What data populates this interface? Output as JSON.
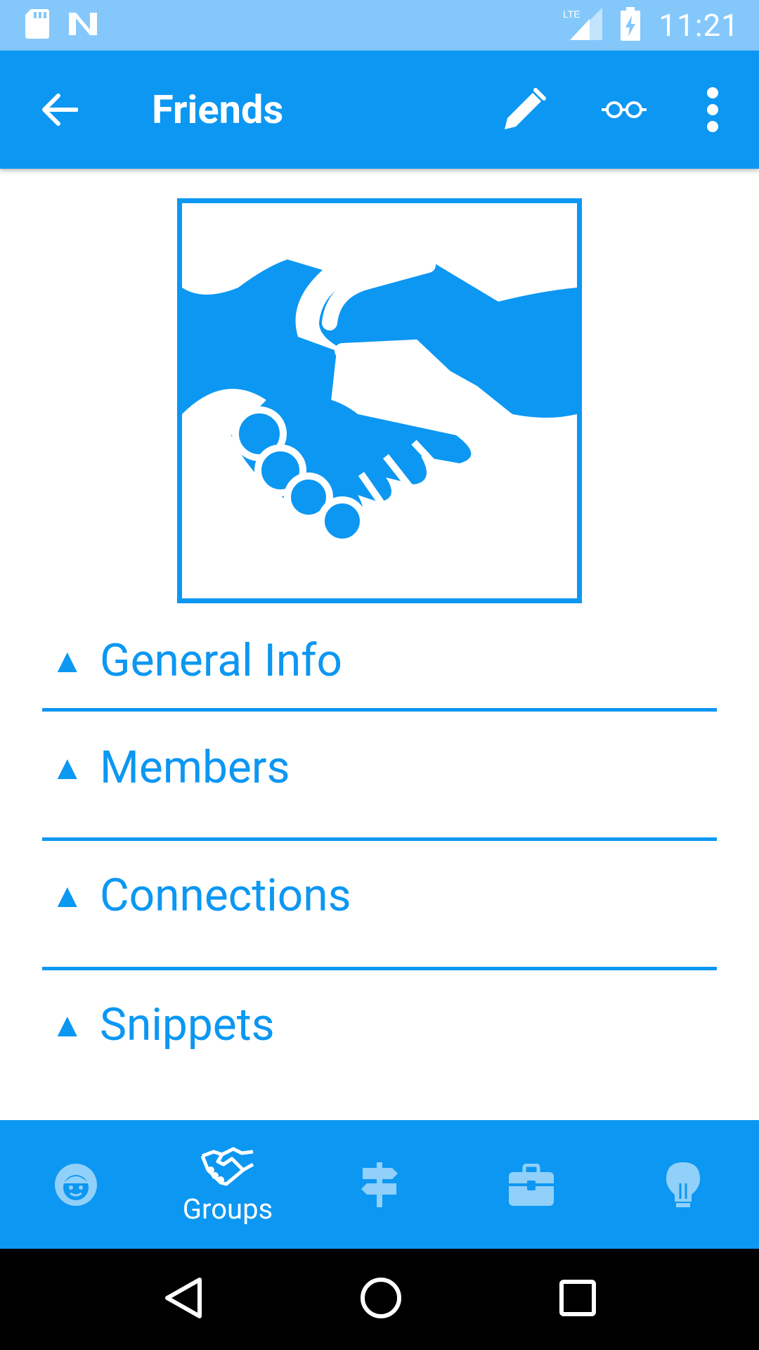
{
  "status_bar": {
    "time": "11:21",
    "network": "LTE",
    "icons": [
      "sd-card-icon",
      "n-notification-icon",
      "lte-signal-icon",
      "battery-charging-icon"
    ]
  },
  "app_bar": {
    "title": "Friends",
    "icons": [
      "arrow-back-icon",
      "pencil-icon",
      "glasses-icon",
      "more-vert-icon"
    ]
  },
  "hero": {
    "icon": "handshake-icon"
  },
  "sections": [
    {
      "arrow": "▲",
      "label": "General Info"
    },
    {
      "arrow": "▲",
      "label": "Members"
    },
    {
      "arrow": "▲",
      "label": "Connections"
    },
    {
      "arrow": "▲",
      "label": "Snippets"
    }
  ],
  "bottom_nav": {
    "items": [
      {
        "icon": "person-face-icon",
        "label": "",
        "active": false
      },
      {
        "icon": "handshake-icon",
        "label": "Groups",
        "active": true
      },
      {
        "icon": "signpost-icon",
        "label": "",
        "active": false
      },
      {
        "icon": "briefcase-icon",
        "label": "",
        "active": false
      },
      {
        "icon": "lightbulb-icon",
        "label": "",
        "active": false
      }
    ]
  },
  "system_nav": {
    "icons": [
      "back-triangle-icon",
      "home-circle-icon",
      "recents-square-icon"
    ]
  },
  "colors": {
    "primary": "#0C97F2",
    "status_bar": "#84C8FB",
    "background": "#FFFFFF"
  }
}
